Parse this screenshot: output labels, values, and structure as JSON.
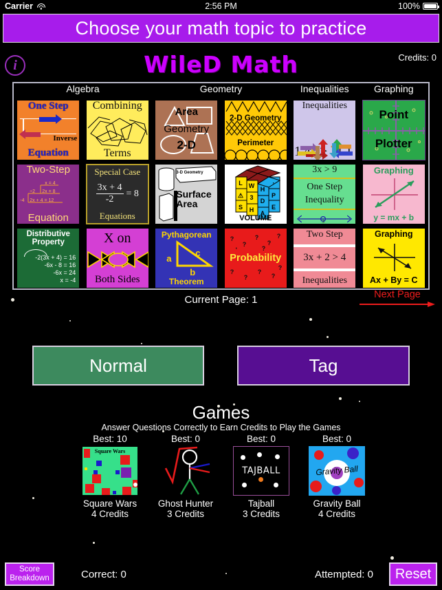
{
  "status_bar": {
    "carrier": "Carrier",
    "time": "2:56 PM",
    "battery": "100%",
    "wifi_icon": "wifi-icon",
    "battery_icon": "battery-icon"
  },
  "banner": {
    "text": "Choose your math topic to practice"
  },
  "header": {
    "logo": "WileD Math",
    "credits": "Credits: 0",
    "info_icon": "info-icon"
  },
  "grid": {
    "columns": [
      "Algebra",
      "Geometry",
      "Inequalities",
      "Graphing"
    ],
    "tiles": [
      {
        "id": "one-step-equation",
        "top": "One Step",
        "mid": "Inverse",
        "bottom": "Equation"
      },
      {
        "id": "combining-terms",
        "top": "Combining",
        "bottom": "Terms"
      },
      {
        "id": "area-geometry-2d",
        "top": "Area",
        "mid": "Geometry",
        "bottom": "2-D"
      },
      {
        "id": "perimeter-2d-geometry",
        "top": "2-D Geometry",
        "bottom": "Perimeter"
      },
      {
        "id": "inequalities-compare",
        "top": "Inequalities",
        "mid": "14 > 11"
      },
      {
        "id": "point-plotter",
        "top": "Point",
        "bottom": "Plotter"
      },
      {
        "id": "two-step-equation",
        "top": "Two-Step",
        "bottom": "Equation",
        "work": [
          "x = 4",
          "÷2",
          "2x = 8",
          "-4",
          "2x + 4 = 12"
        ]
      },
      {
        "id": "special-case-equations",
        "top": "Special Case",
        "num": "3x + 4",
        "den": "-2",
        "eq": "= 8",
        "bottom": "Equations"
      },
      {
        "id": "surface-area",
        "tag": "3-D Geometry",
        "line1": "Surface",
        "line2": "Area"
      },
      {
        "id": "volume-3d-shapes",
        "bottom": "VOLUME",
        "cube_letters": [
          "L",
          "W",
          "H",
          "3",
          "D",
          "S",
          "H",
          "A",
          "P",
          "E",
          "S"
        ]
      },
      {
        "id": "one-step-inequality",
        "top": "3x > 9",
        "mid1": "One Step",
        "mid2": "Inequality",
        "numline": "3"
      },
      {
        "id": "graphing-slope-intercept",
        "top": "Graphing",
        "bottom": "y = mx + b"
      },
      {
        "id": "distributive-property",
        "top": "Distributive Property",
        "steps": [
          "-2(3x + 4) = 16",
          "-6x - 8 = 16",
          "-6x = 24",
          "x = -4"
        ]
      },
      {
        "id": "x-on-both-sides",
        "top": "X on",
        "bottom": "Both Sides"
      },
      {
        "id": "pythagorean-theorem",
        "top": "Pythagorean",
        "bottom": "Theorem",
        "labels": [
          "a",
          "c",
          "b"
        ]
      },
      {
        "id": "probability",
        "mid": "Probability"
      },
      {
        "id": "two-step-inequalities",
        "top": "Two Step",
        "mid": "3x + 2 > 4",
        "bottom": "Inequalities"
      },
      {
        "id": "graphing-standard-form",
        "top": "Graphing",
        "bottom": "Ax + By = C"
      }
    ]
  },
  "pagination": {
    "current_page": "Current Page: 1",
    "next_page": "Next Page"
  },
  "modes": {
    "normal": "Normal",
    "tag": "Tag"
  },
  "games_section": {
    "title": "Games",
    "subtitle": "Answer Questions Correctly to Earn Credits to Play the Games",
    "games": [
      {
        "best": "Best: 10",
        "name": "Square Wars",
        "credits": "4 Credits",
        "thumb_text": "Square Wars"
      },
      {
        "best": "Best: 0",
        "name": "Ghost Hunter",
        "credits": "3 Credits"
      },
      {
        "best": "Best: 0",
        "name": "Tajball",
        "credits": "3 Credits",
        "thumb_text": "TAJBALL"
      },
      {
        "best": "Best: 0",
        "name": "Gravity Ball",
        "credits": "4 Credits",
        "thumb_text": "Gravity Ball"
      }
    ]
  },
  "footer": {
    "score_breakdown_line1": "Score",
    "score_breakdown_line2": "Breakdown",
    "correct": "Correct: 0",
    "attempted": "Attempted: 0",
    "reset": "Reset"
  },
  "colors": {
    "accent": "#a71ceb",
    "logo": "#cc00ff",
    "normal": "#3d8a5e",
    "tag": "#570e92",
    "next_page": "#ef1c1c"
  }
}
